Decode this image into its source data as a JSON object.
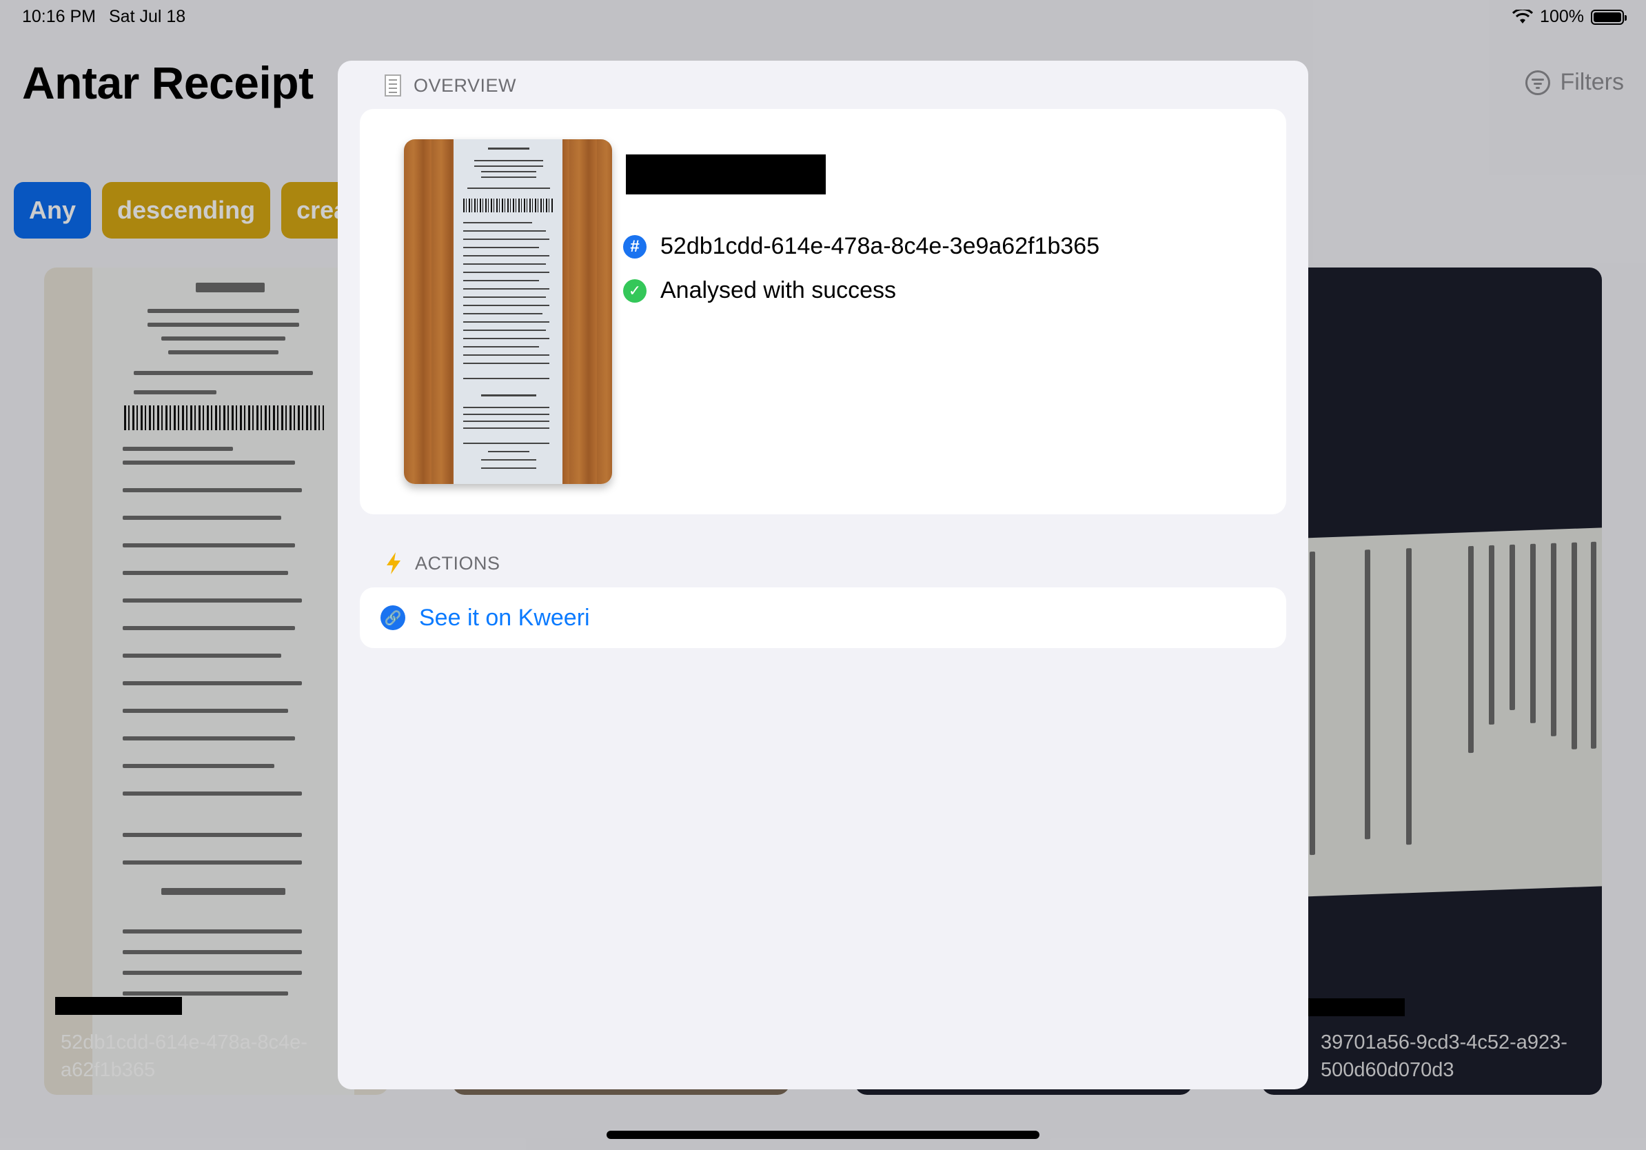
{
  "status_bar": {
    "time": "10:16 PM",
    "date": "Sat Jul 18",
    "battery": "100%"
  },
  "app": {
    "title": "Antar Receipt",
    "filters_label": "Filters",
    "chips": [
      "Any",
      "descending",
      "crea"
    ]
  },
  "cards": [
    {
      "id": "52db1cdd-614e-478a-8c4e-a62f1b365"
    },
    {
      "id": "39701a56-9cd3-4c52-a923-500d60d070d3"
    }
  ],
  "sheet": {
    "overview_header": "OVERVIEW",
    "receipt_id": "52db1cdd-614e-478a-8c4e-3e9a62f1b365",
    "status": "Analysed with success",
    "actions_header": "ACTIONS",
    "action_link": "See it on Kweeri"
  },
  "colors": {
    "accent_blue": "#0a7aff",
    "success_green": "#34c759",
    "chip_yellow": "#d6a813"
  },
  "icons": [
    "wifi-icon",
    "battery-icon",
    "filters-icon",
    "receipt-icon",
    "bolt-icon",
    "hash-icon",
    "checkmark-icon",
    "link-icon"
  ]
}
